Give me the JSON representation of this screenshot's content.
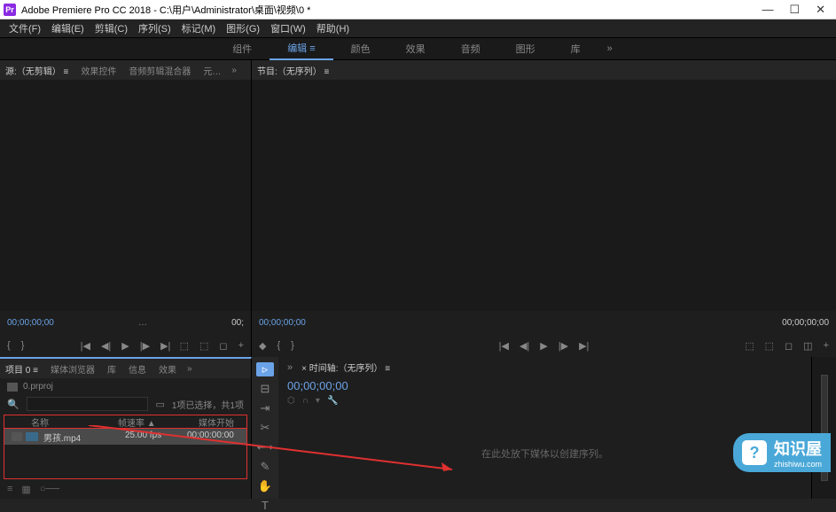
{
  "titlebar": {
    "icon": "Pr",
    "title": "Adobe Premiere Pro CC 2018 - C:\\用户\\Administrator\\桌面\\视频\\0 *"
  },
  "menubar": {
    "items": [
      "文件(F)",
      "编辑(E)",
      "剪辑(C)",
      "序列(S)",
      "标记(M)",
      "图形(G)",
      "窗口(W)",
      "帮助(H)"
    ]
  },
  "workspace": {
    "tabs": [
      "组件",
      "编辑",
      "颜色",
      "效果",
      "音频",
      "图形",
      "库"
    ],
    "active_index": 1,
    "more": "»"
  },
  "source": {
    "tabs": [
      "源:（无剪辑）",
      "效果控件",
      "音频剪辑混合器",
      "元…"
    ],
    "active_index": 0,
    "more": "»",
    "tc_left": "00;00;00;00",
    "tc_right": "00;",
    "center": "…"
  },
  "program": {
    "tabs": [
      "节目:（无序列）"
    ],
    "active_index": 0,
    "tc_left": "00;00;00;00",
    "tc_right": "00;00;00;00"
  },
  "project": {
    "tabs": [
      "项目 0",
      "媒体浏览器",
      "库",
      "信息",
      "效果"
    ],
    "active_index": 0,
    "more": "»",
    "name": "0.prproj",
    "search_info": "1项已选择，共1项",
    "headers": {
      "name": "名称",
      "rate": "帧速率 ▲",
      "start": "媒体开始"
    },
    "items": [
      {
        "name": "男孩.mp4",
        "rate": "25.00 fps",
        "start": "00:00:00:00"
      }
    ]
  },
  "timeline": {
    "tabs": [
      "× 时间轴:（无序列）"
    ],
    "tc": "00;00;00;00",
    "empty_text": "在此处放下媒体以创建序列。"
  },
  "watermark": {
    "icon": "?",
    "title": "知识屋",
    "sub": "zhishiwu.com"
  }
}
